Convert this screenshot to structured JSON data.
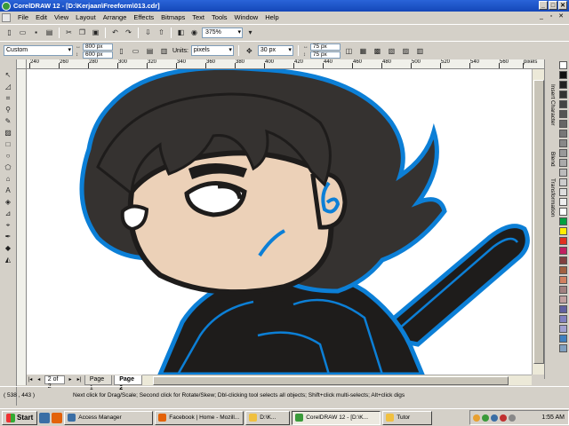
{
  "window": {
    "title": "CorelDRAW 12 - [D:\\Kerjaan\\Freeform\\013.cdr]",
    "controls": [
      "_",
      "□",
      "✕"
    ]
  },
  "menu": {
    "items": [
      "File",
      "Edit",
      "View",
      "Layout",
      "Arrange",
      "Effects",
      "Bitmaps",
      "Text",
      "Tools",
      "Window",
      "Help"
    ],
    "mdi_controls": [
      "_",
      "▫",
      "✕"
    ]
  },
  "standard_toolbar": {
    "zoom": "375%"
  },
  "property_bar": {
    "paper_type": "Custom",
    "width": "800 px",
    "height": "600 px",
    "units_label": "Units:",
    "units": "pixels",
    "nudge": "30 px",
    "duplicate_x": "75 px",
    "duplicate_y": "75 px"
  },
  "ruler": {
    "h_ticks": [
      "240",
      "260",
      "280",
      "300",
      "320",
      "340",
      "360",
      "380",
      "400",
      "420",
      "440",
      "460",
      "480",
      "500",
      "520",
      "540",
      "560"
    ],
    "unit": "pixels"
  },
  "page_nav": {
    "count": "2 of 2",
    "tabs": [
      "Page 1",
      "Page 2"
    ],
    "active_tab": "Page 2"
  },
  "dockers": {
    "tabs": [
      "Insert Character",
      "Blend",
      "Transformation"
    ]
  },
  "palette": {
    "colors": [
      "#ffffff",
      "#111111",
      "#222222",
      "#333333",
      "#444444",
      "#555555",
      "#666666",
      "#777777",
      "#888888",
      "#999999",
      "#aaaaaa",
      "#bbbbbb",
      "#cccccc",
      "#dddddd",
      "#eeeeee",
      "#ffffff",
      "#00a040",
      "#ffee00",
      "#e03020",
      "#c02060",
      "#804040",
      "#a06040",
      "#d08060",
      "#a08080",
      "#c0a0a0",
      "#6060a0",
      "#8080c0",
      "#a0a0d0",
      "#4080c0",
      "#80a0c0"
    ]
  },
  "status": {
    "coords": "( 538 , 443 )",
    "hint": "Next click for Drag/Scale; Second click for Rotate/Skew; Dbl-clicking tool selects all objects; Shift+click multi-selects; Alt+click digs"
  },
  "taskbar": {
    "start": "Start",
    "tasks": [
      {
        "label": "Access Manager",
        "icon_color": "#3a6ea5"
      },
      {
        "label": "Facebook | Home - Mozill...",
        "icon_color": "#e36209"
      },
      {
        "label": "D:\\K...",
        "icon_color": "#f0c040"
      },
      {
        "label": "CorelDRAW 12 - [D:\\K...",
        "icon_color": "#3a9a3a"
      },
      {
        "label": "Tutor",
        "icon_color": "#f0c040"
      }
    ],
    "active_task": "CorelDRAW 12 - [D:\\K...",
    "clock": "1:55 AM"
  },
  "colors": {
    "title_blue": "#1447b8",
    "outline_blue": "#0c7fd6",
    "hair": "#353230",
    "skin": "#ecd1b8",
    "dark_body": "#1e1c1b"
  }
}
